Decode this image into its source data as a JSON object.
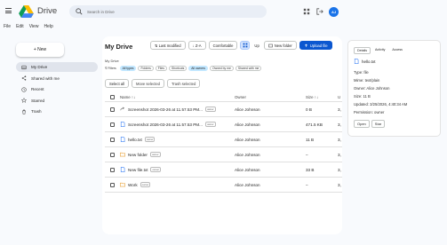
{
  "app": {
    "brand": "Drive"
  },
  "search": {
    "placeholder": "Search in Drive"
  },
  "account": {
    "initials": "AJ"
  },
  "menu": [
    "File",
    "Edit",
    "View",
    "Help"
  ],
  "new_button": "+ New",
  "nav": [
    {
      "label": "My Drive",
      "icon": "drive-icon",
      "active": true
    },
    {
      "label": "Shared with me",
      "icon": "share-icon",
      "active": false
    },
    {
      "label": "Recent",
      "icon": "clock-icon",
      "active": false
    },
    {
      "label": "Starred",
      "icon": "star-icon",
      "active": false
    },
    {
      "label": "Trash",
      "icon": "trash-icon",
      "active": false
    }
  ],
  "main": {
    "title": "My Drive",
    "sort_label": "⇅ Last modified",
    "order_label": "↓ Z-A",
    "view_label": "Comfortable",
    "up_label": "Up",
    "new_folder_label": "New folder",
    "upload_label": "Upload file",
    "breadcrumb": "My Drive",
    "filters": [
      {
        "label": "⊽ Filters",
        "on": false,
        "plain": true
      },
      {
        "label": "All types",
        "on": true
      },
      {
        "label": "Folders",
        "on": false
      },
      {
        "label": "Files",
        "on": false
      },
      {
        "label": "Shortcuts",
        "on": false
      },
      {
        "label": "All owners",
        "on": true
      },
      {
        "label": "Owned by me",
        "on": false
      },
      {
        "label": "Shared with me",
        "on": false
      }
    ],
    "select_all": "Select all",
    "move_selected": "Move selected",
    "trash_selected": "Trash selected",
    "columns": {
      "name": "Name ↑↓",
      "owner": "Owner",
      "size": "Size ↑↓",
      "u": "U"
    },
    "rows": [
      {
        "name": "Screenshot 2026-03-26 at 11.57.53 PM...",
        "badge": "owner",
        "owner": "Alice Johnson",
        "size": "0 B",
        "u": "3,",
        "icon": "shortcut-icon"
      },
      {
        "name": "Screenshot 2026-03-26 at 11.57.53 PM...",
        "badge": "owner",
        "owner": "Alice Johnson",
        "size": "471.5 KB",
        "u": "3,",
        "icon": "file-icon"
      },
      {
        "name": "hello.txt",
        "badge": "owner",
        "owner": "Alice Johnson",
        "size": "11 B",
        "u": "3,",
        "icon": "file-icon"
      },
      {
        "name": "New folder",
        "badge": "owner",
        "owner": "Alice Johnson",
        "size": "–",
        "u": "3,",
        "icon": "folder-icon"
      },
      {
        "name": "New file.txt",
        "badge": "owner",
        "owner": "Alice Johnson",
        "size": "33 B",
        "u": "3,",
        "icon": "file-icon"
      },
      {
        "name": "Work",
        "badge": "owner",
        "owner": "Alice Johnson",
        "size": "–",
        "u": "3,",
        "icon": "folder-icon"
      }
    ]
  },
  "panel": {
    "tabs": [
      {
        "label": "Details",
        "on": true
      },
      {
        "label": "Activity",
        "on": false
      },
      {
        "label": "Access",
        "on": false
      }
    ],
    "file_name": "hello.txt",
    "lines": [
      "Type: file",
      "Mime: text/plain",
      "Owner: Alice Johnson",
      "Size: 11 B",
      "Updated: 3/25/2026, 4:40:34 AM",
      "Permission: owner"
    ],
    "open_label": "Open",
    "star_label": "Star"
  },
  "colors": {
    "accent": "#0b57d0",
    "avatar": "#1a73e8",
    "chip_on": "#c2e7ff",
    "folder": "#e8a33d",
    "file": "#4285f4"
  }
}
